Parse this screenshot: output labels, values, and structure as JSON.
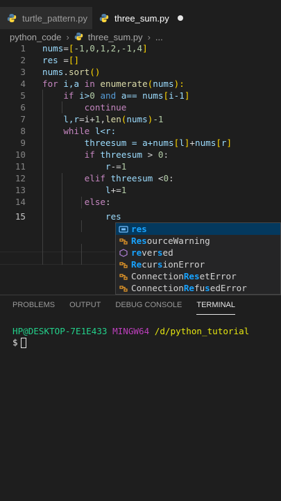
{
  "tabs": [
    {
      "label": "turtle_pattern.py",
      "active": false
    },
    {
      "label": "three_sum.py",
      "active": true,
      "modified": true
    }
  ],
  "breadcrumb": {
    "folder": "python_code",
    "file": "three_sum.py",
    "more": "..."
  },
  "code": {
    "line_numbers": [
      "1",
      "2",
      "3",
      "4",
      "5",
      "6",
      "7",
      "8",
      "9",
      "10",
      "11",
      "12",
      "13",
      "14",
      "15"
    ],
    "current_line": "15",
    "l1": {
      "a": "nums",
      "b": "=",
      "c": "[",
      "d": "-1,0,1,2,-1,4",
      "e": "]"
    },
    "l2": {
      "a": "res",
      "b": " =",
      "c": "[]"
    },
    "l3": {
      "a": "nums",
      "b": ".",
      "c": "sort",
      "d": "()"
    },
    "l4": {
      "a": "for",
      "b": " i,a ",
      "c": "in",
      "d": " enumerate",
      "e": "(",
      "f": "nums",
      "g": "):"
    },
    "l5": {
      "a": "if",
      "b": " i>",
      "c": "0",
      "d": " and",
      "e": " a== ",
      "f": "nums",
      "g": "[",
      "h": "i-1",
      "i": "]",
      ":": ":"
    },
    "l6": {
      "a": "continue"
    },
    "l7": {
      "a": "l,r",
      "b": "=i+",
      "c": "1",
      "d": ",",
      "e": "len",
      "f": "(",
      "g": "nums",
      "h": ")",
      "i": "-1"
    },
    "l8": {
      "a": "while",
      "b": " l<r:"
    },
    "l9": {
      "a": "threesum",
      "b": " = a+",
      "c": "nums",
      "d": "[",
      "e": "l",
      "f": "]",
      "g": "+",
      "h": "nums",
      "i": "[",
      "j": "r",
      "k": "]"
    },
    "l10": {
      "a": "if",
      "b": " threesum",
      "c": " > ",
      "d": "0",
      "e": ":"
    },
    "l11": {
      "a": "r",
      "b": "-=",
      "c": "1"
    },
    "l12": {
      "a": "elif",
      "b": " threesum",
      "c": " <",
      "d": "0",
      "e": ":"
    },
    "l13": {
      "a": "l",
      "b": "+=",
      "c": "1"
    },
    "l14": {
      "a": "else",
      "b": ":"
    },
    "l15": {
      "a": "res"
    }
  },
  "suggestions": [
    {
      "icon": "variable-icon",
      "pre": "",
      "hl": "res",
      "post": ""
    },
    {
      "icon": "class-icon",
      "pre": "",
      "hl": "Res",
      "post": "ourceWarning"
    },
    {
      "icon": "function-icon",
      "pre": "",
      "hl": "re",
      "mid": "ver",
      "hl2": "s",
      "post": "ed"
    },
    {
      "icon": "class-icon",
      "pre": "",
      "hl": "Re",
      "mid": "cur",
      "hl2": "s",
      "post": "ionError"
    },
    {
      "icon": "class-icon",
      "pre": "Connection",
      "hl": "Res",
      "post": "etError"
    },
    {
      "icon": "class-icon",
      "pre": "Connection",
      "hl": "Re",
      "mid": "fu",
      "hl2": "s",
      "post": "edError"
    }
  ],
  "panel": {
    "tabs": [
      "PROBLEMS",
      "OUTPUT",
      "DEBUG CONSOLE",
      "TERMINAL"
    ],
    "active": "TERMINAL"
  },
  "terminal": {
    "user": "HP@DESKTOP-7E1E433",
    "shell": "MINGW64",
    "path": "/d/python_tutorial",
    "prompt": "$"
  },
  "colors": {
    "bg": "#1e1e1e",
    "accent": "#18a3ff"
  }
}
